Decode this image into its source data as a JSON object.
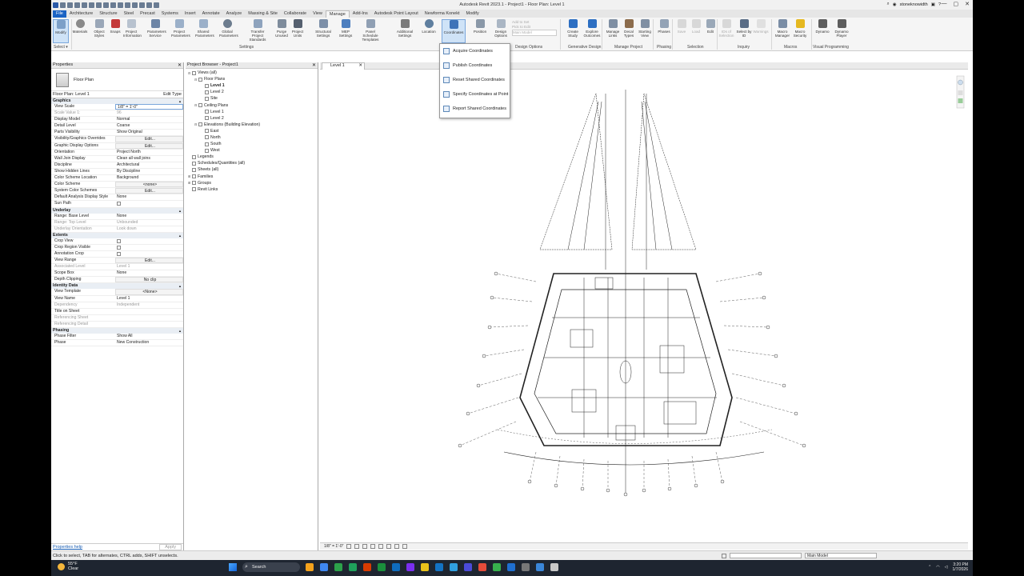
{
  "app": {
    "title": "Autodesk Revit 2023.1 - Project1 - Floor Plan: Level 1",
    "user": "stoneknowidth",
    "window_controls": [
      "—",
      "▢",
      "✕"
    ]
  },
  "tabs": [
    {
      "label": "File"
    },
    {
      "label": "Architecture"
    },
    {
      "label": "Structure"
    },
    {
      "label": "Steel"
    },
    {
      "label": "Precast"
    },
    {
      "label": "Systems"
    },
    {
      "label": "Insert"
    },
    {
      "label": "Annotate"
    },
    {
      "label": "Analyze"
    },
    {
      "label": "Massing & Site"
    },
    {
      "label": "Collaborate"
    },
    {
      "label": "View"
    },
    {
      "label": "Manage"
    },
    {
      "label": "Add-Ins"
    },
    {
      "label": "Autodesk Point Layout"
    },
    {
      "label": "Newforma Konekt"
    },
    {
      "label": "Modify"
    }
  ],
  "ribbon": {
    "buttons": [
      {
        "label": "Modify"
      },
      {
        "label": "Materials"
      },
      {
        "label": "Object Styles"
      },
      {
        "label": "Snaps"
      },
      {
        "label": "Project Information"
      },
      {
        "label": "Parameters Service"
      },
      {
        "label": "Project Parameters"
      },
      {
        "label": "Shared Parameters"
      },
      {
        "label": "Global Parameters"
      },
      {
        "label": "Transfer Project Standards"
      },
      {
        "label": "Purge Unused"
      },
      {
        "label": "Project Units"
      },
      {
        "label": "Structural Settings"
      },
      {
        "label": "MEP Settings"
      },
      {
        "label": "Panel Schedule Templates"
      },
      {
        "label": "Additional Settings"
      },
      {
        "label": "Location"
      },
      {
        "label": "Coordinates"
      },
      {
        "label": "Position"
      },
      {
        "label": "Design Options"
      }
    ],
    "design_options": {
      "add_to_set": "Add to Set",
      "pick_to_edit": "Pick to Edit",
      "main_model": "Main Model"
    },
    "buttons2": [
      {
        "label": "Create Study"
      },
      {
        "label": "Explore Outcomes"
      },
      {
        "label": "Manage Links"
      },
      {
        "label": "Decal Types"
      },
      {
        "label": "Starting View"
      },
      {
        "label": "Phases"
      },
      {
        "label": "Save"
      },
      {
        "label": "Load"
      },
      {
        "label": "Edit"
      },
      {
        "label": "IDs of Selection"
      },
      {
        "label": "Select by ID"
      },
      {
        "label": "Warnings"
      },
      {
        "label": "Macro Manager"
      },
      {
        "label": "Macro Security"
      },
      {
        "label": "Dynamo"
      },
      {
        "label": "Dynamo Player"
      }
    ],
    "panels": {
      "select": "Select ▾",
      "settings": "Settings",
      "design_options": "Design Options",
      "generative": "Generative Design",
      "manage_project": "Manage Project",
      "phasing": "Phasing",
      "selection": "Selection",
      "inquiry": "Inquiry",
      "macros": "Macros",
      "visual": "Visual Programming"
    }
  },
  "coord_menu": {
    "items": [
      {
        "label": "Acquire Coordinates"
      },
      {
        "label": "Publish Coordinates"
      },
      {
        "label": "Reset Shared Coordinates"
      },
      {
        "label": "Specify Coordinates at Point"
      },
      {
        "label": "Report Shared Coordinates"
      }
    ]
  },
  "properties": {
    "title": "Properties",
    "type_name": "Floor Plan",
    "instance": "Floor Plan: Level 1",
    "edit_type": "Edit Type",
    "sections": [
      {
        "name": "Graphics",
        "rows": [
          {
            "k": "View Scale",
            "v": "1/8\" = 1'-0\""
          },
          {
            "k": "Scale Value    1:",
            "v": "96"
          },
          {
            "k": "Display Model",
            "v": "Normal"
          },
          {
            "k": "Detail Level",
            "v": "Coarse"
          },
          {
            "k": "Parts Visibility",
            "v": "Show Original"
          },
          {
            "k": "Visibility/Graphics Overrides",
            "v": "Edit..."
          },
          {
            "k": "Graphic Display Options",
            "v": "Edit..."
          },
          {
            "k": "Orientation",
            "v": "Project North"
          },
          {
            "k": "Wall Join Display",
            "v": "Clean all wall joins"
          },
          {
            "k": "Discipline",
            "v": "Architectural"
          },
          {
            "k": "Show Hidden Lines",
            "v": "By Discipline"
          },
          {
            "k": "Color Scheme Location",
            "v": "Background"
          },
          {
            "k": "Color Scheme",
            "v": "<none>"
          },
          {
            "k": "System Color Schemes",
            "v": "Edit..."
          },
          {
            "k": "Default Analysis Display Style",
            "v": "None"
          },
          {
            "k": "Sun Path",
            "v": ""
          }
        ]
      },
      {
        "name": "Underlay",
        "rows": [
          {
            "k": "Range: Base Level",
            "v": "None"
          },
          {
            "k": "Range: Top Level",
            "v": "Unbounded"
          },
          {
            "k": "Underlay Orientation",
            "v": "Look down"
          }
        ]
      },
      {
        "name": "Extents",
        "rows": [
          {
            "k": "Crop View",
            "v": ""
          },
          {
            "k": "Crop Region Visible",
            "v": ""
          },
          {
            "k": "Annotation Crop",
            "v": ""
          },
          {
            "k": "View Range",
            "v": "Edit..."
          },
          {
            "k": "Associated Level",
            "v": "Level 1"
          },
          {
            "k": "Scope Box",
            "v": "None"
          },
          {
            "k": "Depth Clipping",
            "v": "No clip"
          }
        ]
      },
      {
        "name": "Identity Data",
        "rows": [
          {
            "k": "View Template",
            "v": "<None>"
          },
          {
            "k": "View Name",
            "v": "Level 1"
          },
          {
            "k": "Dependency",
            "v": "Independent"
          },
          {
            "k": "Title on Sheet",
            "v": ""
          },
          {
            "k": "Referencing Sheet",
            "v": ""
          },
          {
            "k": "Referencing Detail",
            "v": ""
          }
        ]
      },
      {
        "name": "Phasing",
        "rows": [
          {
            "k": "Phase Filter",
            "v": "Show All"
          },
          {
            "k": "Phase",
            "v": "New Construction"
          }
        ]
      }
    ],
    "help": "Properties help",
    "apply": "Apply"
  },
  "browser": {
    "title": "Project Browser - Project1",
    "nodes": [
      {
        "label": "Views (all)",
        "level": 0,
        "tw": "⊟"
      },
      {
        "label": "Floor Plans",
        "level": 1,
        "tw": "⊟"
      },
      {
        "label": "Level 1",
        "level": 2,
        "bold": true
      },
      {
        "label": "Level 2",
        "level": 2
      },
      {
        "label": "Site",
        "level": 2
      },
      {
        "label": "Ceiling Plans",
        "level": 1,
        "tw": "⊟"
      },
      {
        "label": "Level 1",
        "level": 2
      },
      {
        "label": "Level 2",
        "level": 2
      },
      {
        "label": "Elevations (Building Elevation)",
        "level": 1,
        "tw": "⊟"
      },
      {
        "label": "East",
        "level": 2
      },
      {
        "label": "North",
        "level": 2
      },
      {
        "label": "South",
        "level": 2
      },
      {
        "label": "West",
        "level": 2
      },
      {
        "label": "Legends",
        "level": 0
      },
      {
        "label": "Schedules/Quantities (all)",
        "level": 0
      },
      {
        "label": "Sheets (all)",
        "level": 0
      },
      {
        "label": "Families",
        "level": 0,
        "tw": "⊞"
      },
      {
        "label": "Groups",
        "level": 0,
        "tw": "⊞"
      },
      {
        "label": "Revit Links",
        "level": 0
      }
    ]
  },
  "view": {
    "tab": "Level 1",
    "scale": "1/8\" = 1'-0\""
  },
  "status": {
    "hint": "Click to select, TAB for alternates, CTRL adds, SHIFT unselects.",
    "workset": "Main Model"
  },
  "taskbar": {
    "weather_temp": "55°F",
    "weather_desc": "Clear",
    "search": "Search",
    "time": "3:20 PM",
    "date": "1/7/2026",
    "icons": [
      "#f4a21c",
      "#3f87f0",
      "#2ca24a",
      "#1fa15b",
      "#d83b01",
      "#1a8f3c",
      "#0f6cbd",
      "#7a2ff0",
      "#e8c21b",
      "#1373c4",
      "#30a0e0",
      "#4b4bd8",
      "#e44c3a",
      "#37b24d",
      "#1f6fd0",
      "#777777",
      "#3a86d8",
      "#c8c8c8"
    ]
  }
}
